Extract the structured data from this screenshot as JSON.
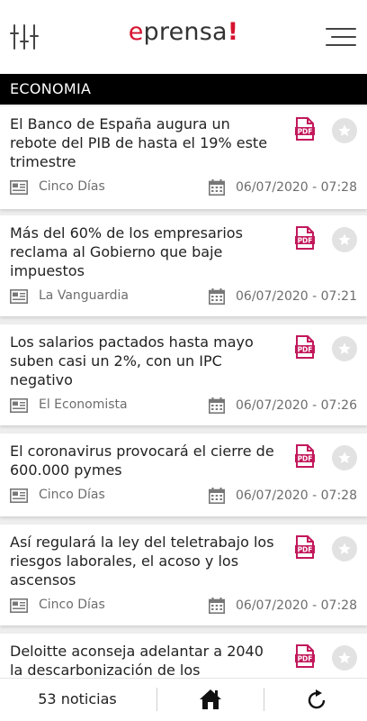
{
  "header": {
    "logo_e": "e",
    "logo_text": "prensa",
    "logo_bang": "!",
    "filter_icon": "sliders-icon",
    "menu_icon": "hamburger-menu-icon"
  },
  "section": {
    "title": "ECONOMIA"
  },
  "articles": [
    {
      "title": "El Banco de España augura un rebote del PIB de hasta el 19% este trimestre",
      "source": "Cinco Días",
      "date": "06/07/2020 - 07:28"
    },
    {
      "title": "Más del 60% de los empresarios reclama al Gobierno que baje impuestos",
      "source": "La Vanguardia",
      "date": "06/07/2020 - 07:21"
    },
    {
      "title": "Los salarios pactados hasta mayo suben casi un 2%, con un IPC negativo",
      "source": "El Economista",
      "date": "06/07/2020 - 07:26"
    },
    {
      "title": "El coronavirus provocará el cierre de 600.000 pymes",
      "source": "Cinco Días",
      "date": "06/07/2020 - 07:28"
    },
    {
      "title": "Así regulará la ley del teletrabajo los riesgos laborales, el acoso y los ascensos",
      "source": "Cinco Días",
      "date": "06/07/2020 - 07:28"
    },
    {
      "title": "Deloitte aconseja adelantar a 2040 la descarbonización de los",
      "source": "",
      "date": ""
    }
  ],
  "footer": {
    "count_label": "53 noticias",
    "home_icon": "home-icon",
    "refresh_icon": "refresh-icon"
  },
  "colors": {
    "brand": "#d6122e",
    "pdf": "#c2185b",
    "section_bg": "#000000"
  }
}
